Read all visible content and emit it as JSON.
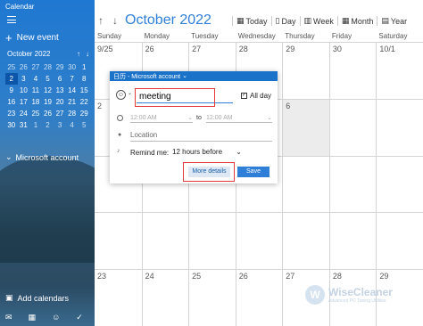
{
  "sidebar": {
    "app_title": "Calendar",
    "new_event": "New event",
    "mini_month": "October 2022",
    "mini_weeks": [
      [
        "25",
        "26",
        "27",
        "28",
        "29",
        "30",
        "1"
      ],
      [
        "2",
        "3",
        "4",
        "5",
        "6",
        "7",
        "8"
      ],
      [
        "9",
        "10",
        "11",
        "12",
        "13",
        "14",
        "15"
      ],
      [
        "16",
        "17",
        "18",
        "19",
        "20",
        "21",
        "22"
      ],
      [
        "23",
        "24",
        "25",
        "26",
        "27",
        "28",
        "29"
      ],
      [
        "30",
        "31",
        "1",
        "2",
        "3",
        "4",
        "5"
      ]
    ],
    "account": "Microsoft account",
    "add_calendars": "Add calendars"
  },
  "header": {
    "month_title": "October 2022",
    "today": "Today",
    "day": "Day",
    "week": "Week",
    "month": "Month",
    "year": "Year"
  },
  "calendar": {
    "weekdays": [
      "Sunday",
      "Monday",
      "Tuesday",
      "Wednesday",
      "Thursday",
      "Friday",
      "Saturday"
    ],
    "weeks": [
      [
        "9/25",
        "26",
        "27",
        "28",
        "29",
        "30",
        "10/1"
      ],
      [
        "2",
        "",
        "",
        "",
        "6",
        "",
        ""
      ],
      [
        "",
        "",
        "",
        "",
        "",
        "",
        ""
      ],
      [
        "",
        "",
        "",
        "",
        "",
        "",
        ""
      ],
      [
        "23",
        "24",
        "25",
        "26",
        "27",
        "28",
        "29"
      ]
    ]
  },
  "popup": {
    "header": "日历 - Microsoft account",
    "title_value": "meeting",
    "all_day": "All day",
    "start_time": "12:00 AM",
    "to": "to",
    "end_time": "12:00 AM",
    "location_placeholder": "Location",
    "remind_label": "Remind me:",
    "remind_value": "12 hours before",
    "more_details": "More details",
    "save": "Save"
  },
  "watermark": {
    "name": "WiseCleaner",
    "tagline": "Advanced PC Tuning Utilities"
  },
  "colors": {
    "accent": "#2f7fd8",
    "highlight": "#e23b3b"
  }
}
